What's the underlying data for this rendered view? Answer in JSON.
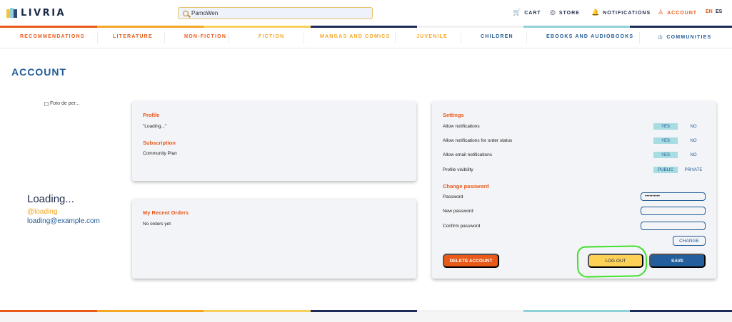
{
  "brand": {
    "name": "LIVRIA"
  },
  "search": {
    "value": "PamoWen",
    "placeholder": ""
  },
  "top_nav": {
    "cart": "CART",
    "store": "STORE",
    "notifications": "NOTIFICATIONS",
    "account": "ACCOUNT",
    "lang_en": "EN",
    "lang_es": "ES"
  },
  "categories": [
    {
      "label": "RECOMMENDATIONS",
      "color": "#e8591a"
    },
    {
      "label": "LITERATURE",
      "color": "#e8591a"
    },
    {
      "label": "NON-FICTION",
      "color": "#e8591a"
    },
    {
      "label": "FICTION",
      "color": "#f5a623"
    },
    {
      "label": "MANGAS AND COMICS",
      "color": "#f5a623"
    },
    {
      "label": "JUVENILE",
      "color": "#f5a623"
    },
    {
      "label": "CHILDREN",
      "color": "#1f5a96"
    },
    {
      "label": "EBOOKS AND AUDIOBOOKS",
      "color": "#1f5a96"
    },
    {
      "label": "COMMUNITIES",
      "color": "#1f5a96"
    }
  ],
  "page": {
    "title": "ACCOUNT"
  },
  "user": {
    "avatar_alt": "Foto de perfil",
    "avatar_alt_shown": "Foto de per...",
    "name": "Loading...",
    "handle": "@loading",
    "email": "loading@example.com"
  },
  "profile": {
    "title": "Profile",
    "value": "\"Loading...\"",
    "subscription_title": "Subscription",
    "subscription_value": "Community Plan"
  },
  "orders": {
    "title": "My Recent Orders",
    "empty": "No orders yet"
  },
  "settings": {
    "title": "Settings",
    "rows": [
      {
        "label": "Allow notifications",
        "on": "YES",
        "off": "NO"
      },
      {
        "label": "Allow notifications for order status",
        "on": "YES",
        "off": "NO"
      },
      {
        "label": "Allow email notifications",
        "on": "YES",
        "off": "NO"
      },
      {
        "label": "Profile visibility",
        "on": "PUBLIC",
        "off": "PRIVATE"
      }
    ],
    "change_password_title": "Change password",
    "password_label": "Password",
    "password_value": "••••••••••",
    "new_password_label": "New password",
    "confirm_password_label": "Confirm password",
    "change_button": "CHANGE",
    "delete_button": "DELETE ACCOUNT",
    "logout_button": "LOG OUT",
    "save_button": "SAVE"
  },
  "colors": {
    "accent_orange": "#e8591a",
    "accent_yellow": "#f5a623",
    "brand_blue": "#1f5a96",
    "toggle_on": "#a6dce2",
    "annotation_green": "#3fe12a"
  },
  "icons": {
    "logo": "books-icon",
    "search": "search-icon",
    "cart": "cart-icon",
    "store": "store-icon",
    "notifications": "bell-icon",
    "account": "user-icon",
    "communities": "crown-icon"
  }
}
